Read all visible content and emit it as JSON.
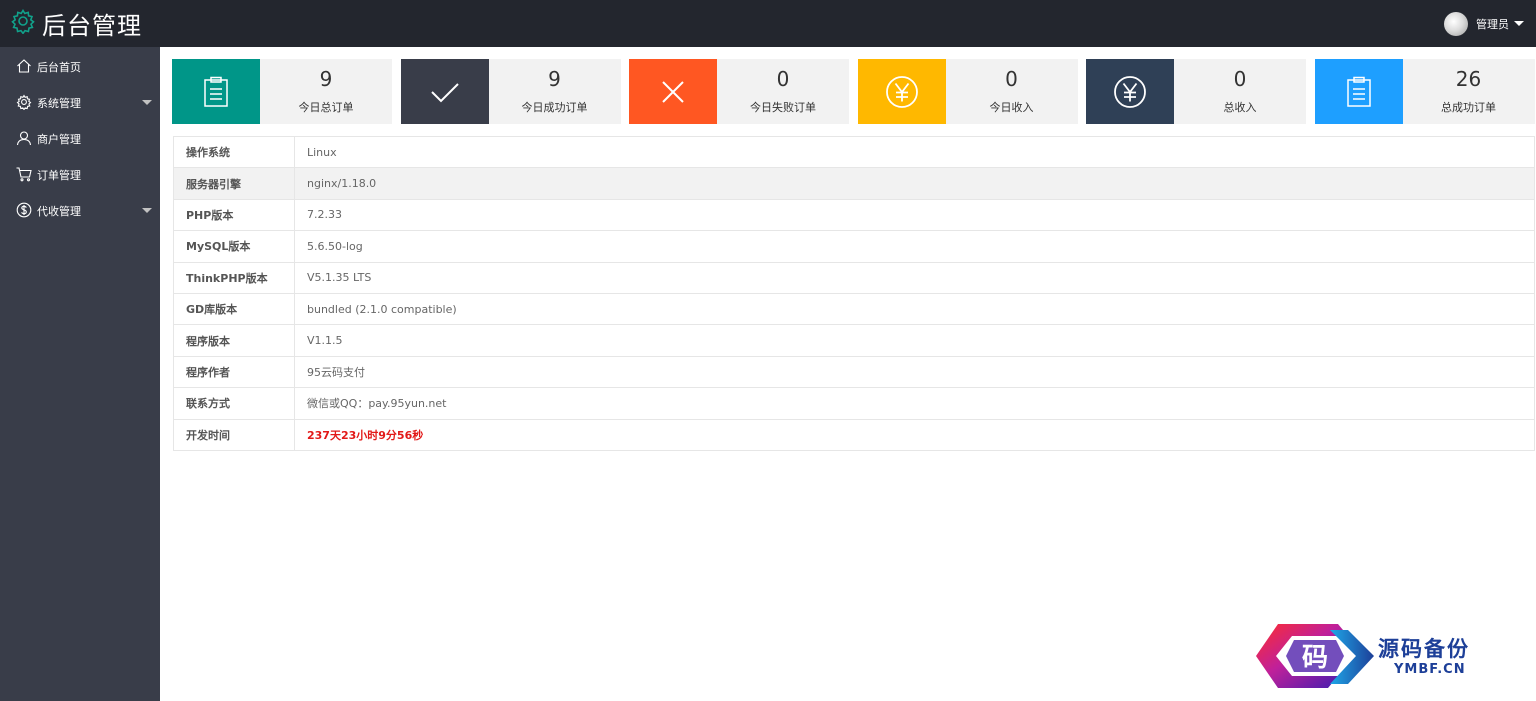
{
  "header": {
    "title": "后台管理",
    "logo_icon": "gear-icon",
    "user_name": "管理员"
  },
  "sidebar": {
    "items": [
      {
        "label": "后台首页",
        "icon": "home-icon",
        "has_submenu": false
      },
      {
        "label": "系统管理",
        "icon": "gear-icon",
        "has_submenu": true
      },
      {
        "label": "商户管理",
        "icon": "user-icon",
        "has_submenu": false
      },
      {
        "label": "订单管理",
        "icon": "cart-icon",
        "has_submenu": false
      },
      {
        "label": "代收管理",
        "icon": "dollar-icon",
        "has_submenu": true
      }
    ]
  },
  "stats": {
    "cards": [
      {
        "value": "9",
        "label": "今日总订单",
        "icon": "clipboard-icon",
        "color": "#009688"
      },
      {
        "value": "9",
        "label": "今日成功订单",
        "icon": "check-icon",
        "color": "#393d49"
      },
      {
        "value": "0",
        "label": "今日失败订单",
        "icon": "close-icon",
        "color": "#ff5722"
      },
      {
        "value": "0",
        "label": "今日收入",
        "icon": "yen-icon",
        "color": "#ffb800"
      },
      {
        "value": "0",
        "label": "总收入",
        "icon": "yen-icon",
        "color": "#2f4056"
      },
      {
        "value": "26",
        "label": "总成功订单",
        "icon": "clipboard-icon",
        "color": "#1e9fff"
      }
    ]
  },
  "info": {
    "rows": [
      {
        "label": "操作系统",
        "value": "Linux"
      },
      {
        "label": "服务器引擎",
        "value": "nginx/1.18.0"
      },
      {
        "label": "PHP版本",
        "value": "7.2.33"
      },
      {
        "label": "MySQL版本",
        "value": "5.6.50-log"
      },
      {
        "label": "ThinkPHP版本",
        "value": "V5.1.35 LTS"
      },
      {
        "label": "GD库版本",
        "value": "bundled (2.1.0 compatible)"
      },
      {
        "label": "程序版本",
        "value": "V1.1.5"
      },
      {
        "label": "程序作者",
        "value": "95云码支付"
      },
      {
        "label": "联系方式",
        "value": "微信或QQ：pay.95yun.net"
      },
      {
        "label": "开发时间",
        "value": "237天23小时9分56秒"
      }
    ]
  },
  "watermark": {
    "glyph": "码",
    "text": "源码备份",
    "sub": "YMBF.CN"
  }
}
